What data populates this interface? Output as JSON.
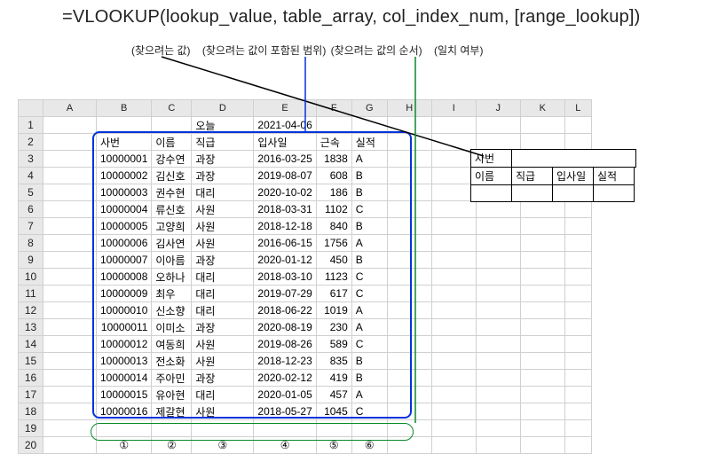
{
  "formula": "=VLOOKUP(lookup_value, table_array, col_index_num, [range_lookup])",
  "annotations": {
    "a1": "(찾으려는 값)",
    "a2": "(찾으려는 값이 포함된 범위)",
    "a3": "(찾으려는 값의 순서)",
    "a4": "(일치 여부)"
  },
  "columns": [
    "A",
    "B",
    "C",
    "D",
    "E",
    "F",
    "G",
    "H",
    "I",
    "J",
    "K",
    "L"
  ],
  "row_headers": [
    "1",
    "2",
    "3",
    "4",
    "5",
    "6",
    "7",
    "8",
    "9",
    "10",
    "11",
    "12",
    "13",
    "14",
    "15",
    "16",
    "17",
    "18",
    "19",
    "20"
  ],
  "header_row": {
    "today_label": "오늘",
    "today_value": "2021-04-06"
  },
  "table_headers": [
    "사번",
    "이름",
    "직급",
    "입사일",
    "근속",
    "실적"
  ],
  "rows": [
    {
      "id": "10000001",
      "name": "강수연",
      "rank": "과장",
      "date": "2016-03-25",
      "days": "1838",
      "grade": "A"
    },
    {
      "id": "10000002",
      "name": "김신호",
      "rank": "과장",
      "date": "2019-08-07",
      "days": "608",
      "grade": "B"
    },
    {
      "id": "10000003",
      "name": "권수현",
      "rank": "대리",
      "date": "2020-10-02",
      "days": "186",
      "grade": "B"
    },
    {
      "id": "10000004",
      "name": "류신호",
      "rank": "사원",
      "date": "2018-03-31",
      "days": "1102",
      "grade": "C"
    },
    {
      "id": "10000005",
      "name": "고양희",
      "rank": "사원",
      "date": "2018-12-18",
      "days": "840",
      "grade": "B"
    },
    {
      "id": "10000006",
      "name": "김사연",
      "rank": "사원",
      "date": "2016-06-15",
      "days": "1756",
      "grade": "A"
    },
    {
      "id": "10000007",
      "name": "이아름",
      "rank": "과장",
      "date": "2020-01-12",
      "days": "450",
      "grade": "B"
    },
    {
      "id": "10000008",
      "name": "오하나",
      "rank": "대리",
      "date": "2018-03-10",
      "days": "1123",
      "grade": "C"
    },
    {
      "id": "10000009",
      "name": "최우",
      "rank": "대리",
      "date": "2019-07-29",
      "days": "617",
      "grade": "C"
    },
    {
      "id": "10000010",
      "name": "신소향",
      "rank": "대리",
      "date": "2018-06-22",
      "days": "1019",
      "grade": "A"
    },
    {
      "id": "10000011",
      "name": "이미소",
      "rank": "과장",
      "date": "2020-08-19",
      "days": "230",
      "grade": "A"
    },
    {
      "id": "10000012",
      "name": "여동희",
      "rank": "사원",
      "date": "2019-08-26",
      "days": "589",
      "grade": "C"
    },
    {
      "id": "10000013",
      "name": "전소화",
      "rank": "사원",
      "date": "2018-12-23",
      "days": "835",
      "grade": "B"
    },
    {
      "id": "10000014",
      "name": "주아민",
      "rank": "과장",
      "date": "2020-02-12",
      "days": "419",
      "grade": "B"
    },
    {
      "id": "10000015",
      "name": "유아현",
      "rank": "대리",
      "date": "2020-01-05",
      "days": "457",
      "grade": "A"
    },
    {
      "id": "10000016",
      "name": "제갈현",
      "rank": "사원",
      "date": "2018-05-27",
      "days": "1045",
      "grade": "C"
    }
  ],
  "footer_circles": [
    "①",
    "②",
    "③",
    "④",
    "⑤",
    "⑥"
  ],
  "lookup_labels": {
    "sabun": "사번",
    "name": "이름",
    "rank": "직급",
    "date": "입사일",
    "grade": "실적"
  }
}
